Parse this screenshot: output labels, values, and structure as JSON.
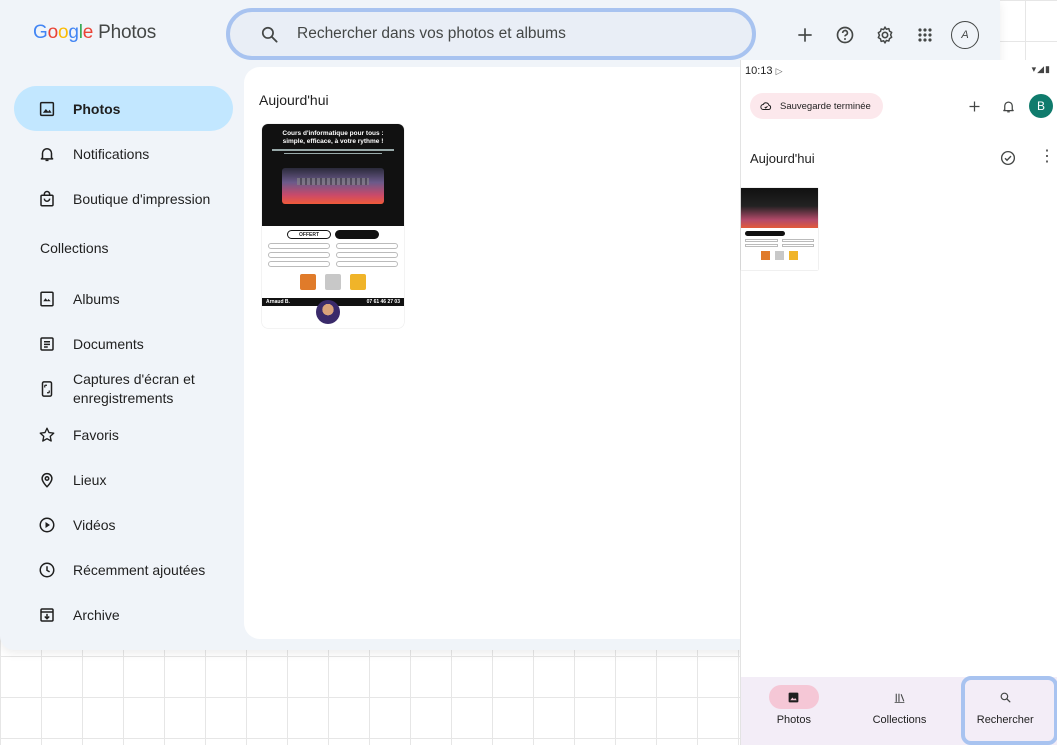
{
  "app": {
    "logo_letters": [
      "G",
      "o",
      "o",
      "g",
      "l",
      "e"
    ],
    "logo_rest": "Photos"
  },
  "search": {
    "placeholder": "Rechercher dans vos photos et albums"
  },
  "top_actions": {
    "add": "+",
    "help": "help-icon",
    "settings": "gear-icon",
    "apps": "apps-grid-icon",
    "avatar": "A"
  },
  "sidebar": {
    "items": [
      {
        "label": "Photos",
        "icon": "photo-icon",
        "active": true
      },
      {
        "label": "Notifications",
        "icon": "bell-icon"
      },
      {
        "label": "Boutique d'impression",
        "icon": "shopping-bag-icon"
      }
    ],
    "collections_title": "Collections",
    "collections": [
      {
        "label": "Albums",
        "icon": "album-icon"
      },
      {
        "label": "Documents",
        "icon": "document-icon"
      },
      {
        "label_line1": "Captures d'écran et",
        "label_line2": "enregistrements",
        "icon": "screenshot-icon"
      },
      {
        "label": "Favoris",
        "icon": "star-icon"
      },
      {
        "label": "Lieux",
        "icon": "location-pin-icon"
      },
      {
        "label": "Vidéos",
        "icon": "play-circle-icon"
      },
      {
        "label": "Récemment ajoutées",
        "icon": "clock-icon"
      },
      {
        "label": "Archive",
        "icon": "archive-icon"
      }
    ]
  },
  "main": {
    "date_heading": "Aujourd'hui",
    "flyer": {
      "title_line1": "Cours d'informatique pour tous :",
      "title_line2": "simple, efficace, à votre rythme !",
      "offer": "OFFERT",
      "name": "Arnaud B.",
      "phone": "07 61 46 27 03"
    }
  },
  "phone": {
    "time": "10:13",
    "status_icons": "wifi-signal-battery",
    "backup_label": "Sauvegarde terminée",
    "avatar_letter": "B",
    "date_heading": "Aujourd'hui",
    "more": "⋮",
    "bottom_nav": [
      {
        "label": "Photos",
        "icon": "photo-icon",
        "active": true
      },
      {
        "label": "Collections",
        "icon": "collections-icon"
      },
      {
        "label": "Rechercher",
        "icon": "search-icon"
      }
    ]
  },
  "colors": {
    "active_nav": "#c2e7ff",
    "highlight_border": "#a8c3f0",
    "phone_active_pill": "#f5c7d6",
    "phone_avatar": "#0f7b6c"
  }
}
